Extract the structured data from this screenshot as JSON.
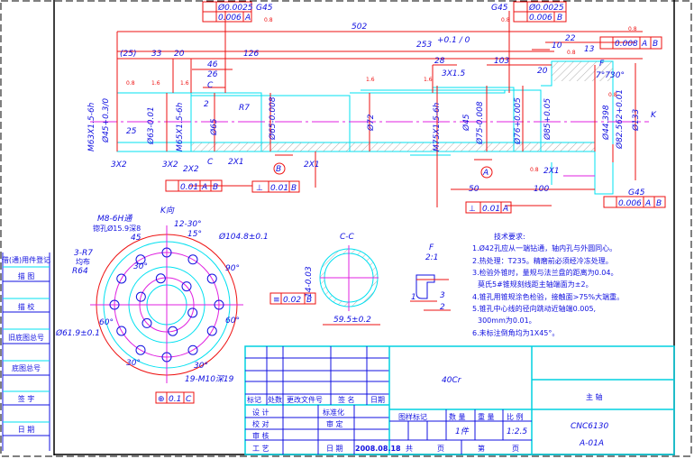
{
  "colors": {
    "dimension": "#ee1111",
    "outline": "#00e0f0",
    "text": "#1010e0",
    "centerline": "#e020e0"
  },
  "side_table": [
    "借(通)用件登记",
    "描 图",
    "描 校",
    "旧底图总号",
    "底图总号",
    "签 字",
    "日 期"
  ],
  "tolerance_frames": {
    "tl_1": "Ø0.0025",
    "tl_2": "0.006",
    "tl_2_ref": "A",
    "tl_grade": "G45",
    "tr_1": "Ø0.0025",
    "tr_2": "0.006",
    "tr_2_ref": "B",
    "tr_grade": "G45",
    "runout_right": "0.008",
    "runout_right_refs": [
      "A",
      "B"
    ],
    "runout_left": "0.01",
    "runout_left_refs": [
      "A",
      "B"
    ],
    "perp_b": "0.01",
    "perp_b_ref": "B",
    "perp_a": "0.01",
    "perp_a_ref": "A",
    "runout_br": "0.006",
    "runout_br_refs": [
      "A",
      "B"
    ],
    "br_grade": "G45",
    "sym_cc": "0.02",
    "sym_cc_ref": "B",
    "pos_k": "0.1",
    "pos_k_ref": "C"
  },
  "dims": [
    "502",
    "253",
    "+0.1 / 0",
    "(25)",
    "33",
    "20",
    "126",
    "46",
    "26",
    "C",
    "2",
    "R7",
    "28",
    "3X1.5",
    "103",
    "20",
    "10",
    "22",
    "13",
    "F",
    "7°7'",
    "30°",
    "M63X1.5-6h",
    "Ø45+0.3/0",
    "25",
    "Ø63-0.01",
    "M65X1.5-6h",
    "Ø65",
    "Ø65-0.008",
    "Ø72",
    "M75X1.5-6h",
    "Ø45",
    "Ø75-0.008",
    "Ø76+0.005",
    "Ø85+0.05",
    "Ø44.398",
    "Ø82.562+0.01",
    "Ø133",
    "K",
    "3X2",
    "3X2",
    "2X2",
    "C",
    "2X1",
    "2X1",
    "2X1",
    "50",
    "100",
    "B",
    "A",
    "0.8",
    "1.6",
    "1.6",
    "1.6",
    "0.8",
    "0.8",
    "0.8",
    "1.6",
    "0.8",
    "0.8",
    "0.8"
  ],
  "k_view": {
    "title": "K向",
    "thread": "M8-6H通",
    "counterbore": "锪孔Ø15.9深8",
    "depth": "45",
    "angle1": "12-30°",
    "angle2": "15°",
    "dia": "Ø104.8±0.1",
    "r7": "3-R7",
    "r7_note": "均布",
    "r64": "R64",
    "a90": "90°",
    "a60": "60°",
    "a60b": "60°",
    "a30": "30°",
    "a30b": "30°",
    "a30c": "30°",
    "dia2": "Ø61.9±0.1",
    "holes": "19-M10深19"
  },
  "section_cc": {
    "title": "C-C",
    "width": "14-0.03",
    "dia": "59.5±0.2"
  },
  "detail_f": {
    "title": "F",
    "scale": "2:1",
    "d1": "1",
    "d2": "3",
    "d3": "2"
  },
  "requirements": {
    "title": "技术要求:",
    "items": [
      "1.Ø42孔应从一端钻通，轴内孔与外圆同心。",
      "2.热处理：T235。精磨前必须经冷冻处理。",
      "3.检验外锥时，量规与法兰盘的距离为0.04。",
      "  莫氏5#锥规刻线距主轴端面为±2。",
      "4.锥孔用锥规涂色检验，接触面>75%大端重。",
      "5.锥孔中心线的径向跳动近轴端0.005,",
      "  300mm为0.01。",
      "6.未标注倒角均为1X45°。"
    ]
  },
  "title_block": {
    "material": "40Cr",
    "part_name": "主 轴",
    "drawing_no_1": "CNC6130",
    "drawing_no_2": "A-01A",
    "hdr": [
      "标记",
      "处数",
      "更改文件号",
      "签 名",
      "日期"
    ],
    "design": "设 计",
    "check": "校 对",
    "review": "审 核",
    "process": "工 艺",
    "standard": "标准化",
    "approve": "审 定",
    "date_label": "日 期",
    "date": "2008.08.18",
    "sample_mark": "图样标记",
    "qty_label": "数 量",
    "weight_label": "重 量",
    "scale_label": "比 例",
    "qty": "1件",
    "scale": "1:2.5",
    "total": "共",
    "page": "页",
    "no": "第",
    "page2": "页"
  }
}
